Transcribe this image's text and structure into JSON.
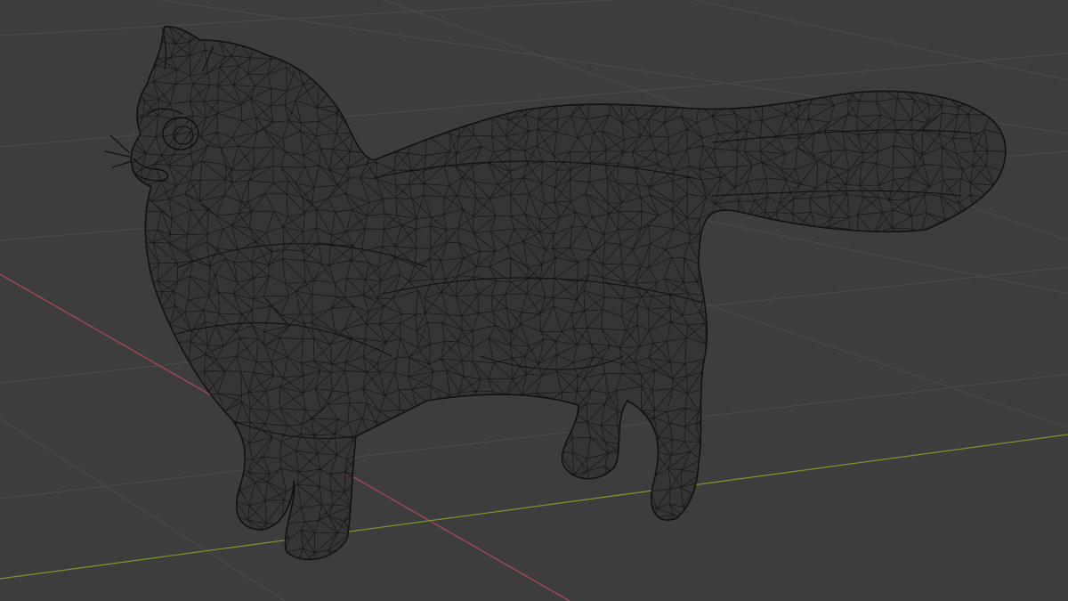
{
  "viewport": {
    "type": "3d-viewport",
    "shading_mode": "wireframe",
    "background_color": "#3d3d3d",
    "grid_color": "#4c4c4c",
    "x_axis_color": "#b5485a",
    "y_axis_color": "#7a9a2a",
    "object": {
      "name_icon": "cat-mesh",
      "wire_color": "#111111",
      "fill_color": "#353535"
    }
  }
}
